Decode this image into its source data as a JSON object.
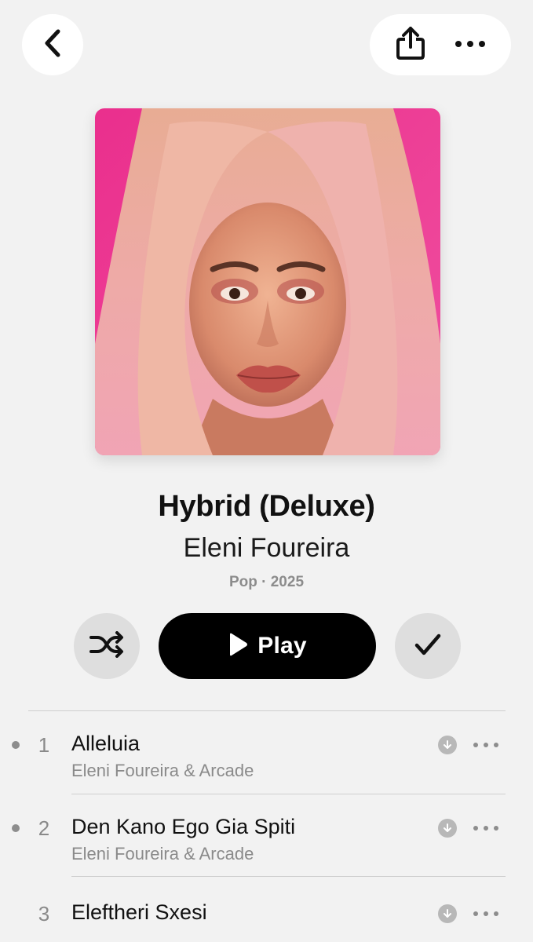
{
  "header": {
    "back_icon": "chevron-left-icon",
    "share_icon": "share-icon",
    "more_icon": "ellipsis-icon"
  },
  "album": {
    "title": "Hybrid (Deluxe)",
    "artist": "Eleni Foureira",
    "meta": "Pop · 2025",
    "artwork_background": "#ee3f96"
  },
  "actions": {
    "shuffle_icon": "shuffle-icon",
    "play_label": "Play",
    "play_icon": "play-icon",
    "library_icon": "checkmark-icon"
  },
  "tracks": [
    {
      "number": "1",
      "title": "Alleluia",
      "artist": "Eleni Foureira & Arcade",
      "has_dot": true
    },
    {
      "number": "2",
      "title": "Den Kano Ego Gia Spiti",
      "artist": "Eleni Foureira & Arcade",
      "has_dot": true
    },
    {
      "number": "3",
      "title": "Eleftheri Sxesi",
      "artist": "",
      "has_dot": false
    }
  ],
  "colors": {
    "background": "#f2f2f2",
    "play_button": "#000000",
    "secondary_text": "#8a8a8a"
  }
}
